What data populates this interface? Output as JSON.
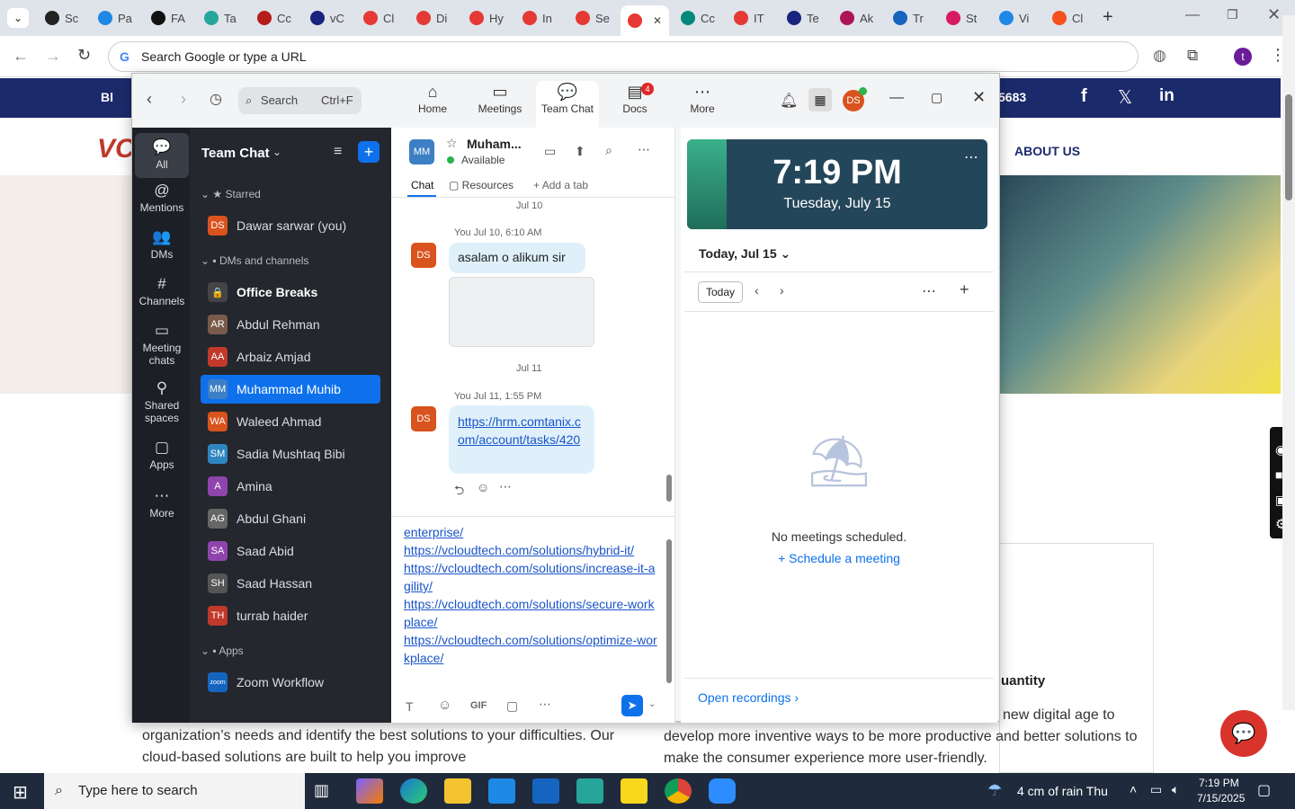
{
  "browser": {
    "tabs": [
      {
        "label": "Sc",
        "color": "#222"
      },
      {
        "label": "Pa",
        "color": "#1e88e5"
      },
      {
        "label": "FA",
        "color": "#111"
      },
      {
        "label": "Ta",
        "color": "#26a69a"
      },
      {
        "label": "Cc",
        "color": "#b71c1c"
      },
      {
        "label": "vC",
        "color": "#1a237e"
      },
      {
        "label": "Cl",
        "color": "#e53935"
      },
      {
        "label": "Di",
        "color": "#e53935"
      },
      {
        "label": "Hy",
        "color": "#e53935"
      },
      {
        "label": "In",
        "color": "#e53935"
      },
      {
        "label": "Se",
        "color": "#e53935"
      },
      {
        "label": "",
        "color": "#e53935"
      },
      {
        "label": "Cc",
        "color": "#00897b"
      },
      {
        "label": "IT",
        "color": "#e53935"
      },
      {
        "label": "Te",
        "color": "#1a237e"
      },
      {
        "label": "Ak",
        "color": "#ad1457"
      },
      {
        "label": "Tr",
        "color": "#1565c0"
      },
      {
        "label": "St",
        "color": "#d81b60"
      },
      {
        "label": "Vi",
        "color": "#1e88e5"
      },
      {
        "label": "Cl",
        "color": "#f4511e"
      }
    ],
    "omnibox_placeholder": "Search Google or type a URL",
    "profile_initial": "t"
  },
  "site": {
    "topbar_text": "Bl",
    "phone_tail": "5683",
    "about_label": "ABOUT US",
    "logo_text": "VC",
    "para_left": "organization’s needs and identify the best solutions to your difficulties. Our cloud-based solutions are built to help you improve",
    "para_right": "new digital age to develop more inventive ways to be more productive and better solutions to make the consumer experience more user-friendly.",
    "heading_tail": "uantity"
  },
  "zoom": {
    "search_label": "Search",
    "search_shortcut": "Ctrl+F",
    "nav": [
      {
        "label": "Home",
        "icon": "⌂"
      },
      {
        "label": "Meetings",
        "icon": "▭"
      },
      {
        "label": "Team Chat",
        "icon": "💬"
      },
      {
        "label": "Docs",
        "icon": "▤",
        "badge": "4"
      },
      {
        "label": "More",
        "icon": "⋯"
      }
    ],
    "user_initials": "DS",
    "rail": [
      {
        "label": "All",
        "icon": "💬"
      },
      {
        "label": "Mentions",
        "icon": "@"
      },
      {
        "label": "DMs",
        "icon": "👥"
      },
      {
        "label": "Channels",
        "icon": "#"
      },
      {
        "label": "Meeting chats",
        "icon": "▭"
      },
      {
        "label": "Shared spaces",
        "icon": "⚲"
      },
      {
        "label": "Apps",
        "icon": "▢"
      },
      {
        "label": "More",
        "icon": "⋯"
      }
    ],
    "sidebar": {
      "title": "Team Chat",
      "sections": {
        "starred": "Starred",
        "dms": "DMs and channels",
        "apps": "Apps"
      },
      "starred_items": [
        {
          "name": "Dawar sarwar (you)",
          "initials": "DS",
          "color": "#d9531e"
        }
      ],
      "items": [
        {
          "name": "Office Breaks",
          "initials": "🔒",
          "color": "#444"
        },
        {
          "name": "Abdul Rehman",
          "initials": "AR",
          "color": "#7a5a4a"
        },
        {
          "name": "Arbaiz Amjad",
          "initials": "AA",
          "color": "#c0392b"
        },
        {
          "name": "Muhammad Muhib",
          "initials": "MM",
          "color": "#3d7fc4"
        },
        {
          "name": "Waleed Ahmad",
          "initials": "WA",
          "color": "#d9531e"
        },
        {
          "name": "Sadia Mushtaq Bibi",
          "initials": "SM",
          "color": "#2e86c1"
        },
        {
          "name": "Amina",
          "initials": "A",
          "color": "#8e44ad"
        },
        {
          "name": "Abdul Ghani",
          "initials": "AG",
          "color": "#666"
        },
        {
          "name": "Saad Abid",
          "initials": "SA",
          "color": "#8e44ad"
        },
        {
          "name": "Saad Hassan",
          "initials": "SH",
          "color": "#555"
        },
        {
          "name": "turrab haider",
          "initials": "TH",
          "color": "#c0392b"
        }
      ],
      "app_items": [
        {
          "name": "Zoom Workflow",
          "initials": "zoom",
          "color": "#1565c0"
        }
      ]
    },
    "chat": {
      "contact_initials": "MM",
      "contact_name": "Muham...",
      "status": "Available",
      "tabs": {
        "chat": "Chat",
        "resources": "Resources",
        "add": "Add a tab"
      },
      "date1": "Jul 10",
      "msg1_meta": "You Jul 10, 6:10 AM",
      "msg1_text": "asalam o alikum sir",
      "date2": "Jul 11",
      "msg2_meta": "You Jul 11, 1:55 PM",
      "msg2_link": "https://hrm.comtanix.com/account/tasks/420",
      "compose_lines": [
        "enterprise/",
        "https://vcloudtech.com/solutions/hybrid-it/",
        "https://vcloudtech.com/solutions/increase-it-agility/",
        "https://vcloudtech.com/solutions/secure-workplace/",
        "https://vcloudtech.com/solutions/optimize-workplace/"
      ]
    },
    "calendar": {
      "time": "7:19 PM",
      "date": "Tuesday, July 15",
      "today_header": "Today, Jul 15",
      "today_btn": "Today",
      "empty": "No meetings scheduled.",
      "schedule": "Schedule a meeting",
      "recordings": "Open recordings"
    }
  },
  "taskbar": {
    "search_placeholder": "Type here to search",
    "weather": "4 cm of rain Thu",
    "time": "7:19 PM",
    "date": "7/15/2025"
  }
}
